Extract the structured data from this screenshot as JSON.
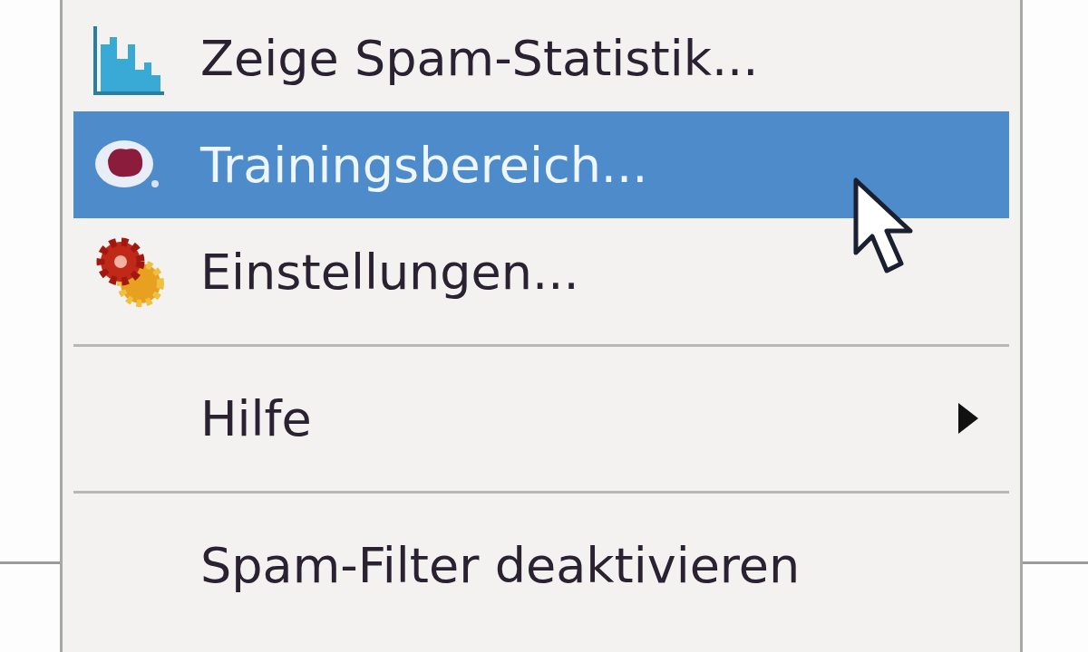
{
  "menu": {
    "items": [
      {
        "kind": "item",
        "label": "Zeige Spam-Statistik...",
        "selected": false,
        "submenu": false
      },
      {
        "kind": "item",
        "label": "Trainingsbereich...",
        "selected": true,
        "submenu": false
      },
      {
        "kind": "item",
        "label": "Einstellungen...",
        "selected": false,
        "submenu": false
      },
      {
        "kind": "separator"
      },
      {
        "kind": "item",
        "label": "Hilfe",
        "selected": false,
        "submenu": true
      },
      {
        "kind": "separator"
      },
      {
        "kind": "item",
        "label": "Spam-Filter deaktivieren",
        "selected": false,
        "submenu": false
      }
    ]
  }
}
